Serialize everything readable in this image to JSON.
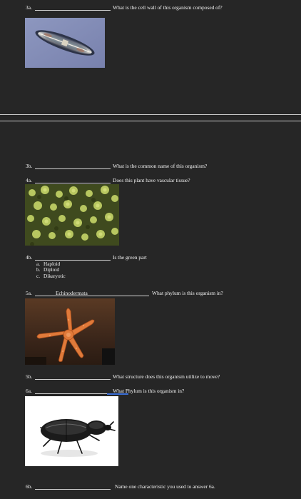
{
  "questions": {
    "q3a": {
      "number": "3a.",
      "text": "What is the cell wall of this organism composed of?"
    },
    "q3b": {
      "number": "3b.",
      "text": "What is the common name of this organism?"
    },
    "q4a": {
      "number": "4a.",
      "text": "Does this plant have vascular tissue?"
    },
    "q4b": {
      "number": "4b.",
      "text": "Is the green part",
      "options": [
        {
          "letter": "a.",
          "label": "Haploid"
        },
        {
          "letter": "b.",
          "label": "Diploid"
        },
        {
          "letter": "c.",
          "label": "Dikaryotic"
        }
      ]
    },
    "q5a": {
      "number": "5a.",
      "answer": "Echinodermata",
      "text": "What phylum is this organism in?"
    },
    "q5b": {
      "number": "5b.",
      "text": "What structure does this organism utilize to move?"
    },
    "q6a": {
      "number": "6a.",
      "text": "What Phylum is this organism in?"
    },
    "q6b": {
      "number": "6b.",
      "text": "Name one characteristic you used to answer 6a."
    }
  },
  "colors": {
    "background": "#262626",
    "text": "#f2f2f2",
    "rule": "#c9c9c9",
    "cursor_blue": "#3b6fd8"
  },
  "images": {
    "diatom": "diatom-micrograph",
    "moss": "moss-photo",
    "starfish": "starfish-photo",
    "beetle": "beetle-photo"
  }
}
